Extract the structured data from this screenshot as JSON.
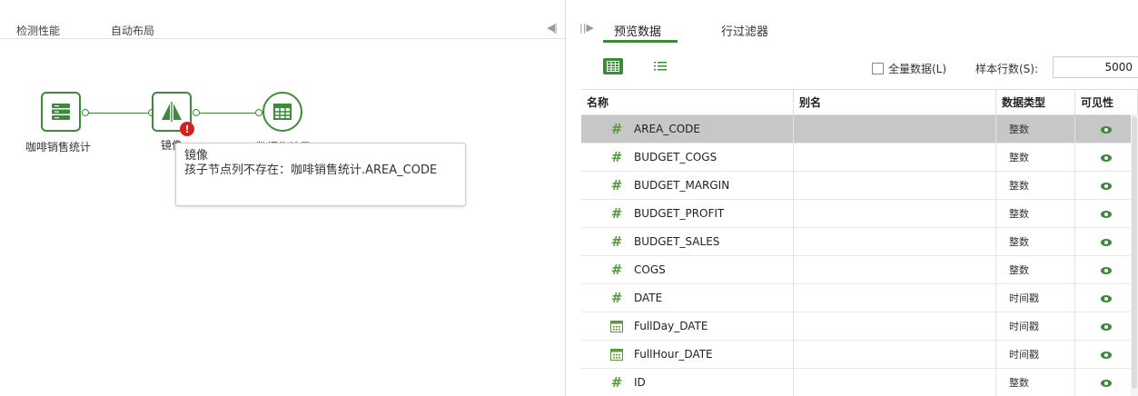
{
  "left_toolbar": {
    "detect_perf": "检测性能",
    "auto_layout": "自动布局"
  },
  "canvas": {
    "nodes": [
      {
        "label": "咖啡销售统计",
        "icon": "database-icon"
      },
      {
        "label": "镜像",
        "icon": "mirror-icon",
        "error": "!"
      },
      {
        "label": "数据集结果",
        "icon": "table-icon"
      }
    ],
    "tooltip": {
      "title": "镜像",
      "message": "孩子节点列不存在：咖啡销售统计.AREA_CODE"
    }
  },
  "right_tabs": {
    "preview": "预览数据",
    "row_filter": "行过滤器"
  },
  "toolbar": {
    "all_data_label": "全量数据(L)",
    "sample_rows_label": "样本行数(S):",
    "sample_rows_value": "5000"
  },
  "table": {
    "columns": [
      "名称",
      "别名",
      "数据类型",
      "可见性"
    ],
    "rows": [
      {
        "icon": "#",
        "name": "AREA_CODE",
        "alias": "",
        "type": "整数",
        "visible": true,
        "selected": true
      },
      {
        "icon": "#",
        "name": "BUDGET_COGS",
        "alias": "",
        "type": "整数",
        "visible": true
      },
      {
        "icon": "#",
        "name": "BUDGET_MARGIN",
        "alias": "",
        "type": "整数",
        "visible": true
      },
      {
        "icon": "#",
        "name": "BUDGET_PROFIT",
        "alias": "",
        "type": "整数",
        "visible": true
      },
      {
        "icon": "#",
        "name": "BUDGET_SALES",
        "alias": "",
        "type": "整数",
        "visible": true
      },
      {
        "icon": "#",
        "name": "COGS",
        "alias": "",
        "type": "整数",
        "visible": true
      },
      {
        "icon": "#",
        "name": "DATE",
        "alias": "",
        "type": "时间戳",
        "visible": true
      },
      {
        "icon": "calendar",
        "name": "FullDay_DATE",
        "alias": "",
        "type": "时间戳",
        "visible": true
      },
      {
        "icon": "calendar",
        "name": "FullHour_DATE",
        "alias": "",
        "type": "时间戳",
        "visible": true
      },
      {
        "icon": "#",
        "name": "ID",
        "alias": "",
        "type": "整数",
        "visible": true
      }
    ]
  }
}
